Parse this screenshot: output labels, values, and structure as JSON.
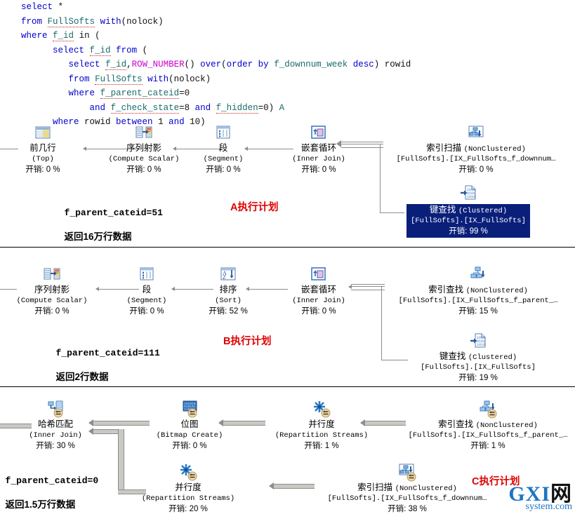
{
  "sql": {
    "lines": [
      [
        {
          "t": "    ",
          "c": "pl"
        },
        {
          "t": "select",
          "c": "kw"
        },
        {
          "t": " *",
          "c": "pl"
        }
      ],
      [
        {
          "t": "    ",
          "c": "pl"
        },
        {
          "t": "from",
          "c": "kw"
        },
        {
          "t": " ",
          "c": "pl"
        },
        {
          "t": "FullSofts",
          "c": "id"
        },
        {
          "t": " ",
          "c": "pl"
        },
        {
          "t": "with",
          "c": "kw"
        },
        {
          "t": "(nolock)",
          "c": "pl"
        }
      ],
      [
        {
          "t": "    ",
          "c": "pl"
        },
        {
          "t": "where",
          "c": "kw"
        },
        {
          "t": " ",
          "c": "pl"
        },
        {
          "t": "f_id",
          "c": "id"
        },
        {
          "t": " in (",
          "c": "pl"
        }
      ],
      [
        {
          "t": "          ",
          "c": "pl"
        },
        {
          "t": "select",
          "c": "kw"
        },
        {
          "t": " ",
          "c": "pl"
        },
        {
          "t": "f_id",
          "c": "id"
        },
        {
          "t": " ",
          "c": "pl"
        },
        {
          "t": "from",
          "c": "kw"
        },
        {
          "t": " (",
          "c": "pl"
        }
      ],
      [
        {
          "t": "             ",
          "c": "pl"
        },
        {
          "t": "select",
          "c": "kw"
        },
        {
          "t": " ",
          "c": "pl"
        },
        {
          "t": "f_id",
          "c": "id"
        },
        {
          "t": ",",
          "c": "pl"
        },
        {
          "t": "ROW_NUMBER",
          "c": "fn"
        },
        {
          "t": "() ",
          "c": "pl"
        },
        {
          "t": "over",
          "c": "kw"
        },
        {
          "t": "(",
          "c": "pl"
        },
        {
          "t": "order by",
          "c": "kw"
        },
        {
          "t": " ",
          "c": "pl"
        },
        {
          "t": "f_downnum_week",
          "c": "idp"
        },
        {
          "t": " ",
          "c": "pl"
        },
        {
          "t": "desc",
          "c": "kw"
        },
        {
          "t": ") rowid",
          "c": "pl"
        }
      ],
      [
        {
          "t": "             ",
          "c": "pl"
        },
        {
          "t": "from",
          "c": "kw"
        },
        {
          "t": " ",
          "c": "pl"
        },
        {
          "t": "FullSofts",
          "c": "id"
        },
        {
          "t": " ",
          "c": "pl"
        },
        {
          "t": "with",
          "c": "kw"
        },
        {
          "t": "(nolock)",
          "c": "pl"
        }
      ],
      [
        {
          "t": "             ",
          "c": "pl"
        },
        {
          "t": "where",
          "c": "kw"
        },
        {
          "t": " ",
          "c": "pl"
        },
        {
          "t": "f_parent_cateid",
          "c": "id"
        },
        {
          "t": "=0",
          "c": "pl"
        }
      ],
      [
        {
          "t": "                 ",
          "c": "pl"
        },
        {
          "t": "and",
          "c": "kw"
        },
        {
          "t": " ",
          "c": "pl"
        },
        {
          "t": "f_check_state",
          "c": "id"
        },
        {
          "t": "=8 ",
          "c": "pl"
        },
        {
          "t": "and",
          "c": "kw"
        },
        {
          "t": " ",
          "c": "pl"
        },
        {
          "t": "f_hidden",
          "c": "id"
        },
        {
          "t": "=0) ",
          "c": "pl"
        },
        {
          "t": "A",
          "c": "idp"
        }
      ],
      [
        {
          "t": "          ",
          "c": "pl"
        },
        {
          "t": "where",
          "c": "kw"
        },
        {
          "t": " rowid ",
          "c": "pl"
        },
        {
          "t": "between",
          "c": "kw"
        },
        {
          "t": " 1 ",
          "c": "pl"
        },
        {
          "t": "and",
          "c": "kw"
        },
        {
          "t": " 10)",
          "c": "pl"
        }
      ]
    ]
  },
  "plans": [
    {
      "id": "A",
      "tag": "A执行计划",
      "annotation_line1": "f_parent_cateid=51",
      "annotation_line2": "返回16万行数据",
      "nodes": [
        {
          "key": "top",
          "icon": "top-icon",
          "name": "前几行",
          "qualifier": "",
          "type": "(Top)",
          "cost": "开销: 0 %",
          "selected": false
        },
        {
          "key": "compute-scalar",
          "icon": "compute-scalar-icon",
          "name": "序列射影",
          "qualifier": "",
          "type": "(Compute Scalar)",
          "cost": "开销: 0 %",
          "selected": false
        },
        {
          "key": "segment",
          "icon": "segment-icon",
          "name": "段",
          "qualifier": "",
          "type": "(Segment)",
          "cost": "开销: 0 %",
          "selected": false
        },
        {
          "key": "nested-loops",
          "icon": "nested-loops-icon",
          "name": "嵌套循环",
          "qualifier": "",
          "type": "(Inner Join)",
          "cost": "开销: 0 %",
          "selected": false
        },
        {
          "key": "index-scan",
          "icon": "index-scan-icon",
          "name": "索引扫描",
          "qualifier": "(NonClustered)",
          "type": "[FullSofts].[IX_FullSofts_f_downnum…",
          "cost": "开销: 0 %",
          "selected": false
        },
        {
          "key": "key-lookup",
          "icon": "key-lookup-icon",
          "name": "键查找",
          "qualifier": "(Clustered)",
          "type": "[FullSofts].[IX_FullSofts]",
          "cost": "开销: 99 %",
          "selected": true
        }
      ]
    },
    {
      "id": "B",
      "tag": "B执行计划",
      "annotation_line1": "f_parent_cateid=111",
      "annotation_line2": "返回2行数据",
      "nodes": [
        {
          "key": "compute-scalar",
          "icon": "compute-scalar-icon",
          "name": "序列射影",
          "qualifier": "",
          "type": "(Compute Scalar)",
          "cost": "开销: 0 %",
          "selected": false
        },
        {
          "key": "segment",
          "icon": "segment-icon",
          "name": "段",
          "qualifier": "",
          "type": "(Segment)",
          "cost": "开销: 0 %",
          "selected": false
        },
        {
          "key": "sort",
          "icon": "sort-icon",
          "name": "排序",
          "qualifier": "",
          "type": "(Sort)",
          "cost": "开销: 52 %",
          "selected": false
        },
        {
          "key": "nested-loops",
          "icon": "nested-loops-icon",
          "name": "嵌套循环",
          "qualifier": "",
          "type": "(Inner Join)",
          "cost": "开销: 0 %",
          "selected": false
        },
        {
          "key": "index-seek",
          "icon": "index-seek-icon",
          "name": "索引查找",
          "qualifier": "(NonClustered)",
          "type": "[FullSofts].[IX_FullSofts_f_parent_…",
          "cost": "开销: 15 %",
          "selected": false
        },
        {
          "key": "key-lookup",
          "icon": "key-lookup-icon",
          "name": "键查找",
          "qualifier": "(Clustered)",
          "type": "[FullSofts].[IX_FullSofts]",
          "cost": "开销: 19 %",
          "selected": false
        }
      ]
    },
    {
      "id": "C",
      "tag": "C执行计划",
      "annotation_line1": "f_parent_cateid=0",
      "annotation_line2": "返回1.5万行数据",
      "nodes": [
        {
          "key": "hash-match",
          "icon": "hash-match-icon",
          "name": "哈希匹配",
          "qualifier": "",
          "type": "(Inner Join)",
          "cost": "开销: 30 %",
          "selected": false
        },
        {
          "key": "bitmap-create",
          "icon": "bitmap-icon",
          "name": "位图",
          "qualifier": "",
          "type": "(Bitmap Create)",
          "cost": "开销: 0 %",
          "selected": false
        },
        {
          "key": "parallelism-top",
          "icon": "parallelism-icon",
          "name": "并行度",
          "qualifier": "",
          "type": "(Repartition Streams)",
          "cost": "开销: 1 %",
          "selected": false
        },
        {
          "key": "index-seek",
          "icon": "index-seek-icon",
          "name": "索引查找",
          "qualifier": "(NonClustered)",
          "type": "[FullSofts].[IX_FullSofts_f_parent_…",
          "cost": "开销: 1 %",
          "selected": false
        },
        {
          "key": "parallelism-bottom",
          "icon": "parallelism-icon",
          "name": "并行度",
          "qualifier": "",
          "type": "(Repartition Streams)",
          "cost": "开销: 20 %",
          "selected": false
        },
        {
          "key": "index-scan",
          "icon": "index-scan-icon",
          "name": "索引扫描",
          "qualifier": "(NonClustered)",
          "type": "[FullSofts].[IX_FullSofts_f_downnum…",
          "cost": "开销: 38 %",
          "selected": false
        }
      ]
    }
  ],
  "watermark": {
    "brand": "GXI",
    "brand_cn": "网",
    "site": "system.com"
  },
  "colors": {
    "keyword": "#0000cc",
    "identifier": "#1a6b6b",
    "function": "#cc00cc",
    "selected_bg": "#0a1f7a",
    "tag": "#e00000",
    "connector": "#9a9a9a"
  }
}
